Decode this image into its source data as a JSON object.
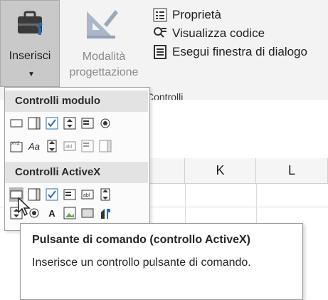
{
  "ribbon": {
    "insert_label": "Inserisci",
    "design_mode_line1": "Modalità",
    "design_mode_line2": "progettazione",
    "properties_label": "Proprietà",
    "view_code_label": "Visualizza codice",
    "run_dialog_label": "Esegui finestra di dialogo",
    "group_label": "Controlli"
  },
  "dropdown": {
    "form_controls_header": "Controlli modulo",
    "activex_header": "Controlli ActiveX"
  },
  "sheet": {
    "columns": [
      "K",
      "L"
    ]
  },
  "tooltip": {
    "title": "Pulsante di comando (controllo ActiveX)",
    "description": "Inserisce un controllo pulsante di comando."
  },
  "colors": {
    "ribbon_bg": "#f3f3f3",
    "selected_btn": "#c9c9c9",
    "section_header": "#e3e3e3",
    "icon_blue": "#2b6cb0"
  }
}
